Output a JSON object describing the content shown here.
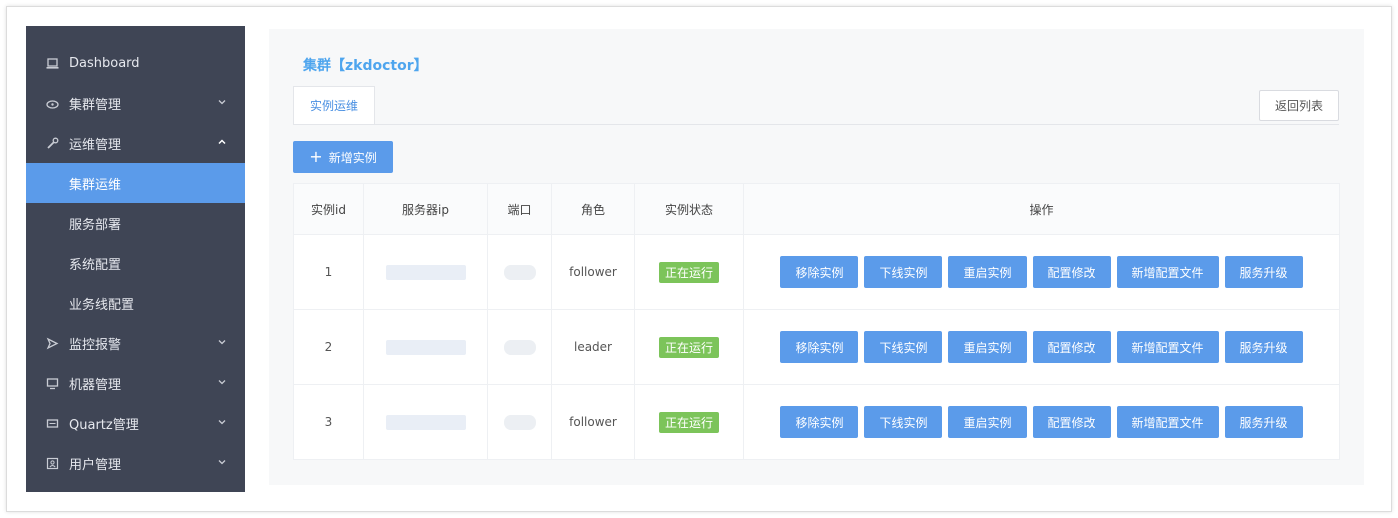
{
  "sidebar": {
    "items": [
      {
        "label": "Dashboard",
        "icon": "laptop-icon",
        "arrow": ""
      },
      {
        "label": "集群管理",
        "icon": "cloud-icon",
        "arrow": "down"
      },
      {
        "label": "运维管理",
        "icon": "wrench-icon",
        "arrow": "up"
      },
      {
        "label": "集群运维",
        "icon": "",
        "arrow": "",
        "sub": true,
        "active": true
      },
      {
        "label": "服务部署",
        "icon": "",
        "arrow": "",
        "sub": true
      },
      {
        "label": "系统配置",
        "icon": "",
        "arrow": "",
        "sub": true
      },
      {
        "label": "业务线配置",
        "icon": "",
        "arrow": "",
        "sub": true
      },
      {
        "label": "监控报警",
        "icon": "send-icon",
        "arrow": "down"
      },
      {
        "label": "机器管理",
        "icon": "monitor-icon",
        "arrow": "down"
      },
      {
        "label": "Quartz管理",
        "icon": "calendar-icon",
        "arrow": "down"
      },
      {
        "label": "用户管理",
        "icon": "user-card-icon",
        "arrow": "down"
      }
    ]
  },
  "main": {
    "title": "集群【zkdoctor】",
    "tab": "实例运维",
    "back_button": "返回列表",
    "add_button": "新增实例",
    "table": {
      "headers": [
        "实例id",
        "服务器ip",
        "端口",
        "角色",
        "实例状态",
        "操作"
      ],
      "rows": [
        {
          "id": "1",
          "role": "follower",
          "status": "正在运行"
        },
        {
          "id": "2",
          "role": "leader",
          "status": "正在运行"
        },
        {
          "id": "3",
          "role": "follower",
          "status": "正在运行"
        }
      ],
      "actions": [
        "移除实例",
        "下线实例",
        "重启实例",
        "配置修改",
        "新增配置文件",
        "服务升级"
      ]
    }
  },
  "colors": {
    "sidebar_bg": "#3f4555",
    "accent": "#5b9bea",
    "status_green": "#7cc45a",
    "title_blue": "#4ea5ee"
  }
}
